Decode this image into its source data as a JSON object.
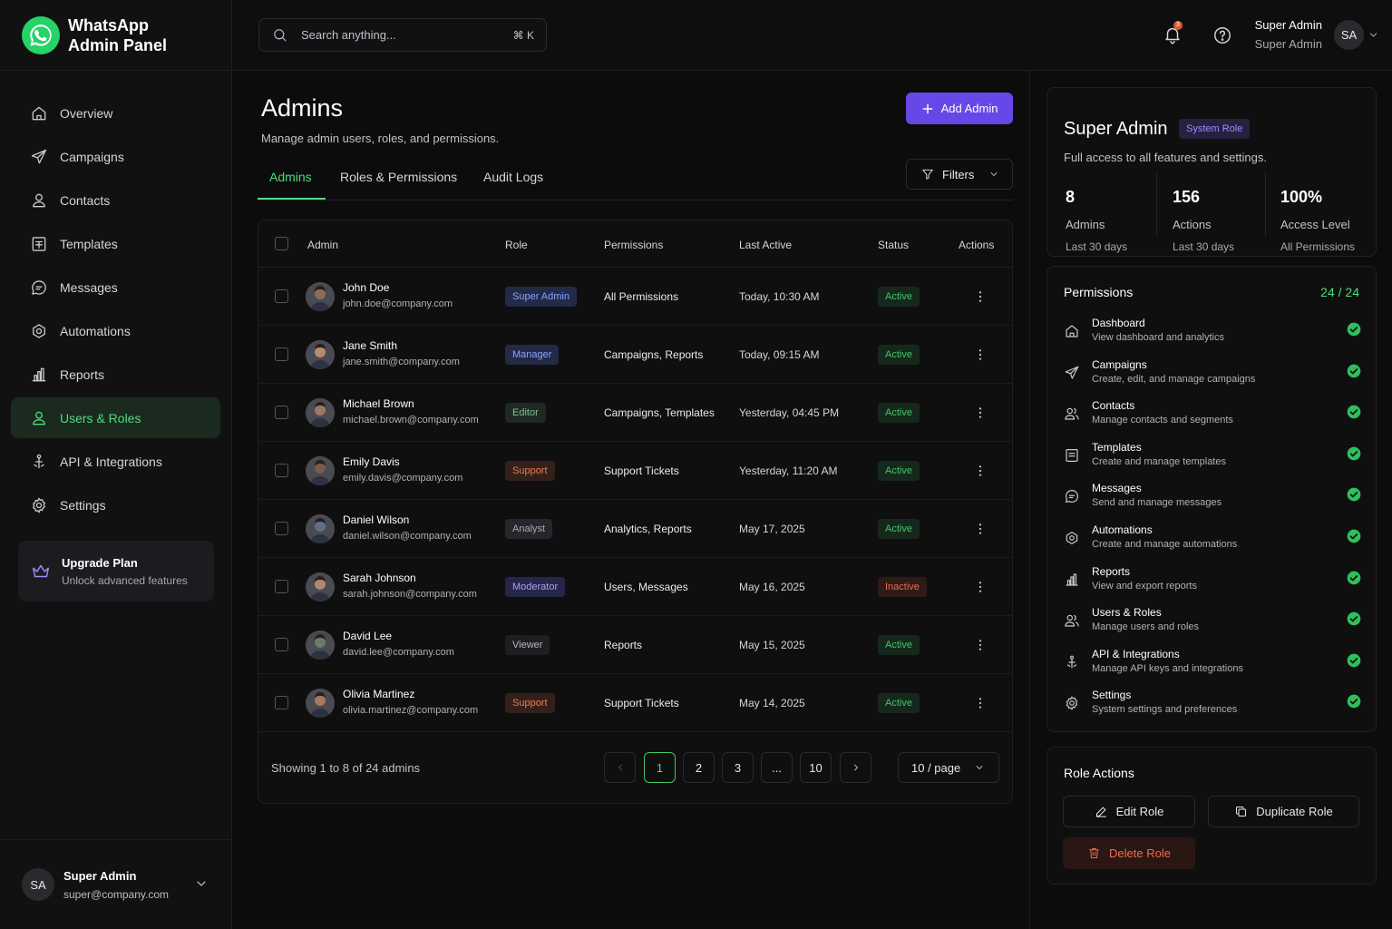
{
  "brand": {
    "line1": "WhatsApp",
    "line2": "Admin Panel"
  },
  "sidebar": {
    "items": [
      {
        "label": "Overview",
        "icon": "home-icon"
      },
      {
        "label": "Campaigns",
        "icon": "send-icon"
      },
      {
        "label": "Contacts",
        "icon": "users-icon"
      },
      {
        "label": "Templates",
        "icon": "template-icon"
      },
      {
        "label": "Messages",
        "icon": "message-icon"
      },
      {
        "label": "Automations",
        "icon": "automation-icon"
      },
      {
        "label": "Reports",
        "icon": "chart-icon"
      },
      {
        "label": "Users & Roles",
        "icon": "user-icon",
        "active": true
      },
      {
        "label": "API & Integrations",
        "icon": "plug-icon"
      },
      {
        "label": "Settings",
        "icon": "gear-icon"
      }
    ],
    "upgrade": {
      "title": "Upgrade Plan",
      "subtitle": "Unlock advanced features"
    },
    "user": {
      "initials": "SA",
      "name": "Super Admin",
      "email": "super@company.com"
    }
  },
  "topbar": {
    "search_placeholder": "Search anything...",
    "search_shortcut": "⌘ K",
    "notification_count": "3",
    "user_name": "Super Admin",
    "user_role": "Super Admin",
    "user_initials": "SA"
  },
  "page": {
    "title": "Admins",
    "subtitle": "Manage admin users, roles, and permissions.",
    "add_button": "Add Admin",
    "tabs": [
      "Admins",
      "Roles & Permissions",
      "Audit Logs"
    ],
    "filters_label": "Filters"
  },
  "table": {
    "headers": [
      "Admin",
      "Role",
      "Permissions",
      "Last Active",
      "Status",
      "Actions"
    ],
    "rows": [
      {
        "name": "John Doe",
        "email": "john.doe@company.com",
        "role": "Super Admin",
        "permissions": "All Permissions",
        "last_active": "Today, 10:30 AM",
        "status": "Active"
      },
      {
        "name": "Jane Smith",
        "email": "jane.smith@company.com",
        "role": "Manager",
        "permissions": "Campaigns, Reports",
        "last_active": "Today, 09:15 AM",
        "status": "Active"
      },
      {
        "name": "Michael Brown",
        "email": "michael.brown@company.com",
        "role": "Editor",
        "permissions": "Campaigns, Templates",
        "last_active": "Yesterday, 04:45 PM",
        "status": "Active"
      },
      {
        "name": "Emily Davis",
        "email": "emily.davis@company.com",
        "role": "Support",
        "permissions": "Support Tickets",
        "last_active": "Yesterday, 11:20 AM",
        "status": "Active"
      },
      {
        "name": "Daniel Wilson",
        "email": "daniel.wilson@company.com",
        "role": "Analyst",
        "permissions": "Analytics, Reports",
        "last_active": "May 17, 2025",
        "status": "Active"
      },
      {
        "name": "Sarah Johnson",
        "email": "sarah.johnson@company.com",
        "role": "Moderator",
        "permissions": "Users, Messages",
        "last_active": "May 16, 2025",
        "status": "Inactive"
      },
      {
        "name": "David Lee",
        "email": "david.lee@company.com",
        "role": "Viewer",
        "permissions": "Reports",
        "last_active": "May 15, 2025",
        "status": "Active"
      },
      {
        "name": "Olivia Martinez",
        "email": "olivia.martinez@company.com",
        "role": "Support",
        "permissions": "Support Tickets",
        "last_active": "May 14, 2025",
        "status": "Active"
      }
    ],
    "footer_text": "Showing 1 to 8 of 24 admins",
    "pages": [
      "1",
      "2",
      "3",
      "...",
      "10"
    ],
    "per_page": "10 / page"
  },
  "role_colors": {
    "Super Admin": {
      "bg": "#232a48",
      "fg": "#8aa2ff"
    },
    "Manager": {
      "bg": "#232a48",
      "fg": "#8aa2ff"
    },
    "Editor": {
      "bg": "#1f2a23",
      "fg": "#7dbf8d"
    },
    "Support": {
      "bg": "#33201a",
      "fg": "#f07a4f"
    },
    "Analyst": {
      "bg": "#26262c",
      "fg": "#a9a9b0"
    },
    "Moderator": {
      "bg": "#26264a",
      "fg": "#a3a3f2"
    },
    "Viewer": {
      "bg": "#1f1f23",
      "fg": "#b5b5ba"
    }
  },
  "role_panel": {
    "title": "Super Admin",
    "badge": "System Role",
    "subtitle": "Full access to all features and settings.",
    "stats": [
      {
        "value": "8",
        "label": "Admins",
        "sub": "Last 30 days"
      },
      {
        "value": "156",
        "label": "Actions",
        "sub": "Last 30 days"
      },
      {
        "value": "100%",
        "label": "Access Level",
        "sub": "All Permissions"
      }
    ],
    "permissions_title": "Permissions",
    "permissions_count": "24 / 24",
    "permissions": [
      {
        "title": "Dashboard",
        "desc": "View dashboard and analytics",
        "icon": "home-icon"
      },
      {
        "title": "Campaigns",
        "desc": "Create, edit, and manage campaigns",
        "icon": "send-icon"
      },
      {
        "title": "Contacts",
        "desc": "Manage contacts and segments",
        "icon": "users-icon"
      },
      {
        "title": "Templates",
        "desc": "Create and manage templates",
        "icon": "template-icon"
      },
      {
        "title": "Messages",
        "desc": "Send and manage messages",
        "icon": "message-icon"
      },
      {
        "title": "Automations",
        "desc": "Create and manage automations",
        "icon": "automation-icon"
      },
      {
        "title": "Reports",
        "desc": "View and export reports",
        "icon": "chart-icon"
      },
      {
        "title": "Users & Roles",
        "desc": "Manage users and roles",
        "icon": "users-icon"
      },
      {
        "title": "API & Integrations",
        "desc": "Manage API keys and integrations",
        "icon": "plug-icon"
      },
      {
        "title": "Settings",
        "desc": "System settings and preferences",
        "icon": "gear-icon"
      }
    ],
    "actions_title": "Role Actions",
    "edit_label": "Edit Role",
    "duplicate_label": "Duplicate Role",
    "delete_label": "Delete Role"
  }
}
